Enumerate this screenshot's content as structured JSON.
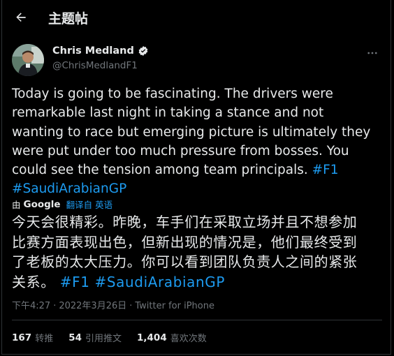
{
  "header": {
    "title": "主题帖"
  },
  "author": {
    "name": "Chris Medland",
    "handle": "@ChrisMedlandF1",
    "verified": true
  },
  "tweet": {
    "lines": [
      "Today is going to be fascinating. The drivers were",
      "remarkable last night in taking a stance and not",
      "wanting to race but emerging picture is ultimately they",
      "were put under too much pressure from bosses. You",
      "could see the tension among team principals. "
    ],
    "hashtag_f1": "#F1",
    "hashtag_gp": "#SaudiArabianGP"
  },
  "translation": {
    "by_prefix": "由",
    "provider": "Google",
    "action": "翻译自 英语",
    "text": "今天会很精彩。昨晚，车手们在采取立场并且不想参加\n比赛方面表现出色，但新出现的情况是，他们最终受到\n了老板的太大压力。你可以看到团队负责人之间的紧张\n关系。 ",
    "hashtags": "#F1 #SaudiArabianGP"
  },
  "meta": {
    "time": "下午4:27",
    "date": "2022年3月26日",
    "client": "Twitter for iPhone"
  },
  "stats": {
    "retweets": {
      "count": "167",
      "label": "转推"
    },
    "quotes": {
      "count": "54",
      "label": "引用推文"
    },
    "likes": {
      "count": "1,404",
      "label": "喜欢次数"
    }
  },
  "colors": {
    "background": "#000000",
    "text": "#e7e9ea",
    "secondary": "#71767b",
    "accent": "#1d9bf0",
    "divider": "#2f3336"
  }
}
